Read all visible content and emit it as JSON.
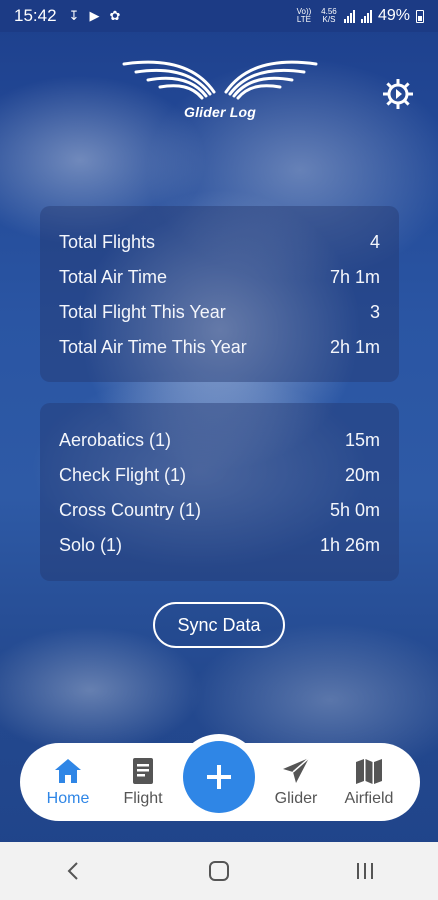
{
  "status_bar": {
    "time": "15:42",
    "network": "Vo)) LTE",
    "speed": "4.56 K/S",
    "battery": "49%"
  },
  "header": {
    "app_name": "Glider Log"
  },
  "stats": [
    {
      "label": "Total Flights",
      "value": "4"
    },
    {
      "label": "Total Air Time",
      "value": "7h 1m"
    },
    {
      "label": "Total Flight This Year",
      "value": "3"
    },
    {
      "label": "Total Air Time This Year",
      "value": "2h 1m"
    }
  ],
  "flight_types": [
    {
      "label": "Aerobatics (1)",
      "value": "15m"
    },
    {
      "label": "Check Flight (1)",
      "value": "20m"
    },
    {
      "label": "Cross Country (1)",
      "value": "5h 0m"
    },
    {
      "label": "Solo (1)",
      "value": "1h 26m"
    }
  ],
  "sync_button": {
    "label": "Sync Data"
  },
  "bottom_nav": {
    "items": [
      {
        "label": "Home",
        "icon": "home-icon",
        "active": true
      },
      {
        "label": "Flight",
        "icon": "logbook-icon",
        "active": false
      },
      {
        "label": "Glider",
        "icon": "paper-plane-icon",
        "active": false
      },
      {
        "label": "Airfield",
        "icon": "map-icon",
        "active": false
      }
    ],
    "fab_icon": "plus-icon"
  },
  "colors": {
    "accent": "#2f86e6",
    "inactive": "#555555",
    "card": "rgba(35,55,110,0.42)"
  }
}
